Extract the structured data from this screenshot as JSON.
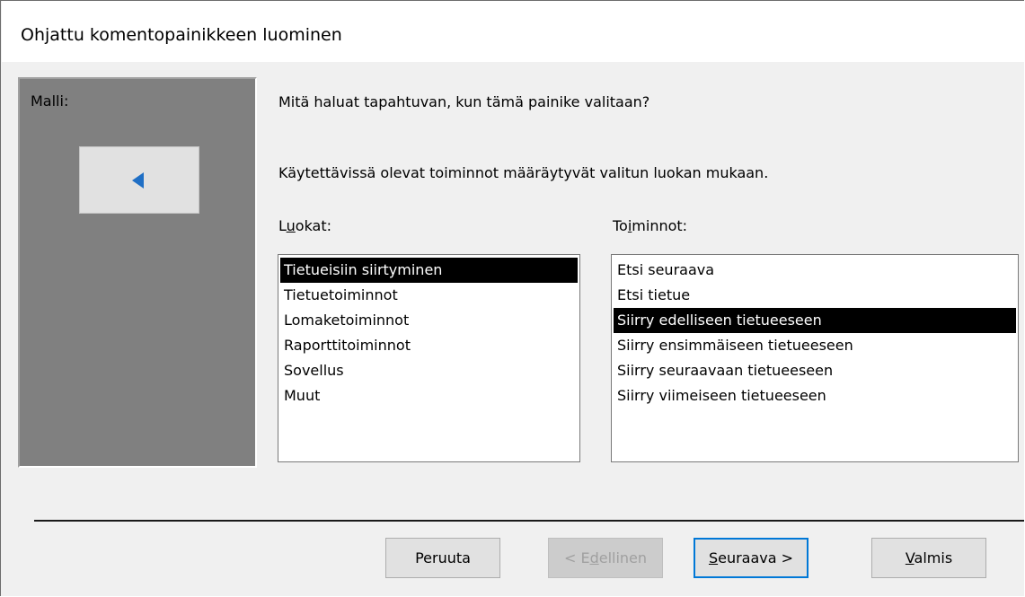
{
  "window": {
    "title": "Ohjattu komentopainikkeen luominen"
  },
  "preview": {
    "label": "Malli:",
    "sample_icon": "left-triangle-icon",
    "accent_color": "#1f6fc5"
  },
  "prompt": {
    "question": "Mitä haluat tapahtuvan, kun tämä painike valitaan?",
    "info": "Käytettävissä olevat toiminnot määräytyvät valitun luokan mukaan."
  },
  "categories": {
    "label_pre": "L",
    "label_accel": "u",
    "label_post": "okat:",
    "items": [
      "Tietueisiin siirtyminen",
      "Tietuetoiminnot",
      "Lomaketoiminnot",
      "Raporttitoiminnot",
      "Sovellus",
      "Muut"
    ],
    "selected": "Tietueisiin siirtyminen"
  },
  "actions": {
    "label_pre": "To",
    "label_accel": "i",
    "label_post": "minnot:",
    "items": [
      "Etsi seuraava",
      "Etsi tietue",
      "Siirry edelliseen tietueeseen",
      "Siirry ensimmäiseen tietueeseen",
      "Siirry seuraavaan tietueeseen",
      "Siirry viimeiseen tietueeseen"
    ],
    "selected": "Siirry edelliseen tietueeseen"
  },
  "buttons": {
    "cancel": "Peruuta",
    "prev_pre": "< E",
    "prev_accel": "d",
    "prev_post": "ellinen",
    "next_accel": "S",
    "next_post": "euraava >",
    "finish_accel": "V",
    "finish_post": "almis"
  }
}
